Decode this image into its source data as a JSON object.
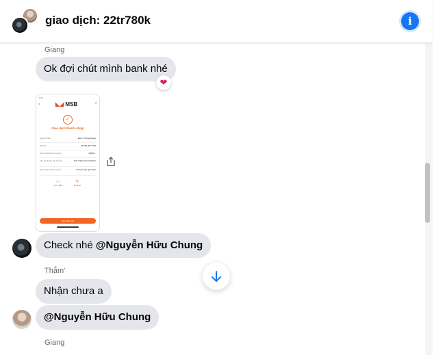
{
  "header": {
    "title": "giao dịch: 22tr780k",
    "info_icon": "info-icon"
  },
  "messages": [
    {
      "sender": "Giang",
      "text": "Ok đợi chút mình bank nhé",
      "reaction": "❤"
    },
    {
      "sender": "",
      "text_prefix": "Check nhé ",
      "mention": "@Nguyễn Hữu Chung"
    },
    {
      "sender": "Thắm'",
      "text": "Nhận chưa a"
    },
    {
      "sender": "",
      "mention": "@Nguyễn Hữu Chung"
    },
    {
      "sender": "Giang"
    }
  ],
  "receipt": {
    "status_bar": "9:41",
    "bank": "MSB",
    "success_text": "Giao dịch thành công!",
    "rows": [
      {
        "k": "Người nhận",
        "v": "Đàm Trường Giang"
      },
      {
        "k": "Số tiền",
        "v": "22,780,000 VND"
      },
      {
        "k": "Số tài khoản thụ hưởng",
        "v": "19036..."
      },
      {
        "k": "Tên tài khoản thụ hưởng",
        "v": "NGUYEN HUU CHUNG"
      },
      {
        "k": "Nội dung chuyển khoản",
        "v": "Chuyển tiền giao dịch"
      }
    ],
    "action_1": "Lưu mẫu",
    "action_2": "Chia sẻ",
    "button": "Giao dịch mới"
  },
  "colors": {
    "accent": "#1876f2",
    "bubble": "#e4e6eb",
    "msb_orange": "#f26522",
    "heart": "#e0245e"
  }
}
